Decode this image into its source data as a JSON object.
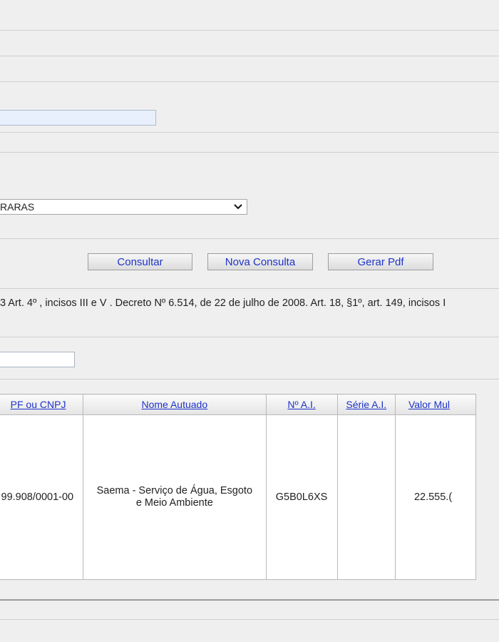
{
  "form": {
    "name_input_value": "",
    "selected_option": "RARAS",
    "cpf_input_value": ""
  },
  "buttons": {
    "consultar": "Consultar",
    "nova_consulta": "Nova Consulta",
    "gerar_pdf": "Gerar Pdf"
  },
  "legal_text": "3 Art. 4º , incisos III e V . Decreto Nº 6.514, de 22 de julho de 2008. Art. 18, §1º, art. 149, incisos I",
  "table": {
    "headers": [
      "PF ou CNPJ",
      "Nome Autuado",
      "Nº A.I.",
      "Série A.I.",
      "Valor Mul"
    ],
    "rows": [
      {
        "doc": "99.908/0001-00",
        "nome": "Saema - Serviço de Água, Esgoto e Meio Ambiente",
        "num_ai": "G5B0L6XS",
        "serie_ai": "",
        "valor": "22.555.("
      }
    ]
  }
}
